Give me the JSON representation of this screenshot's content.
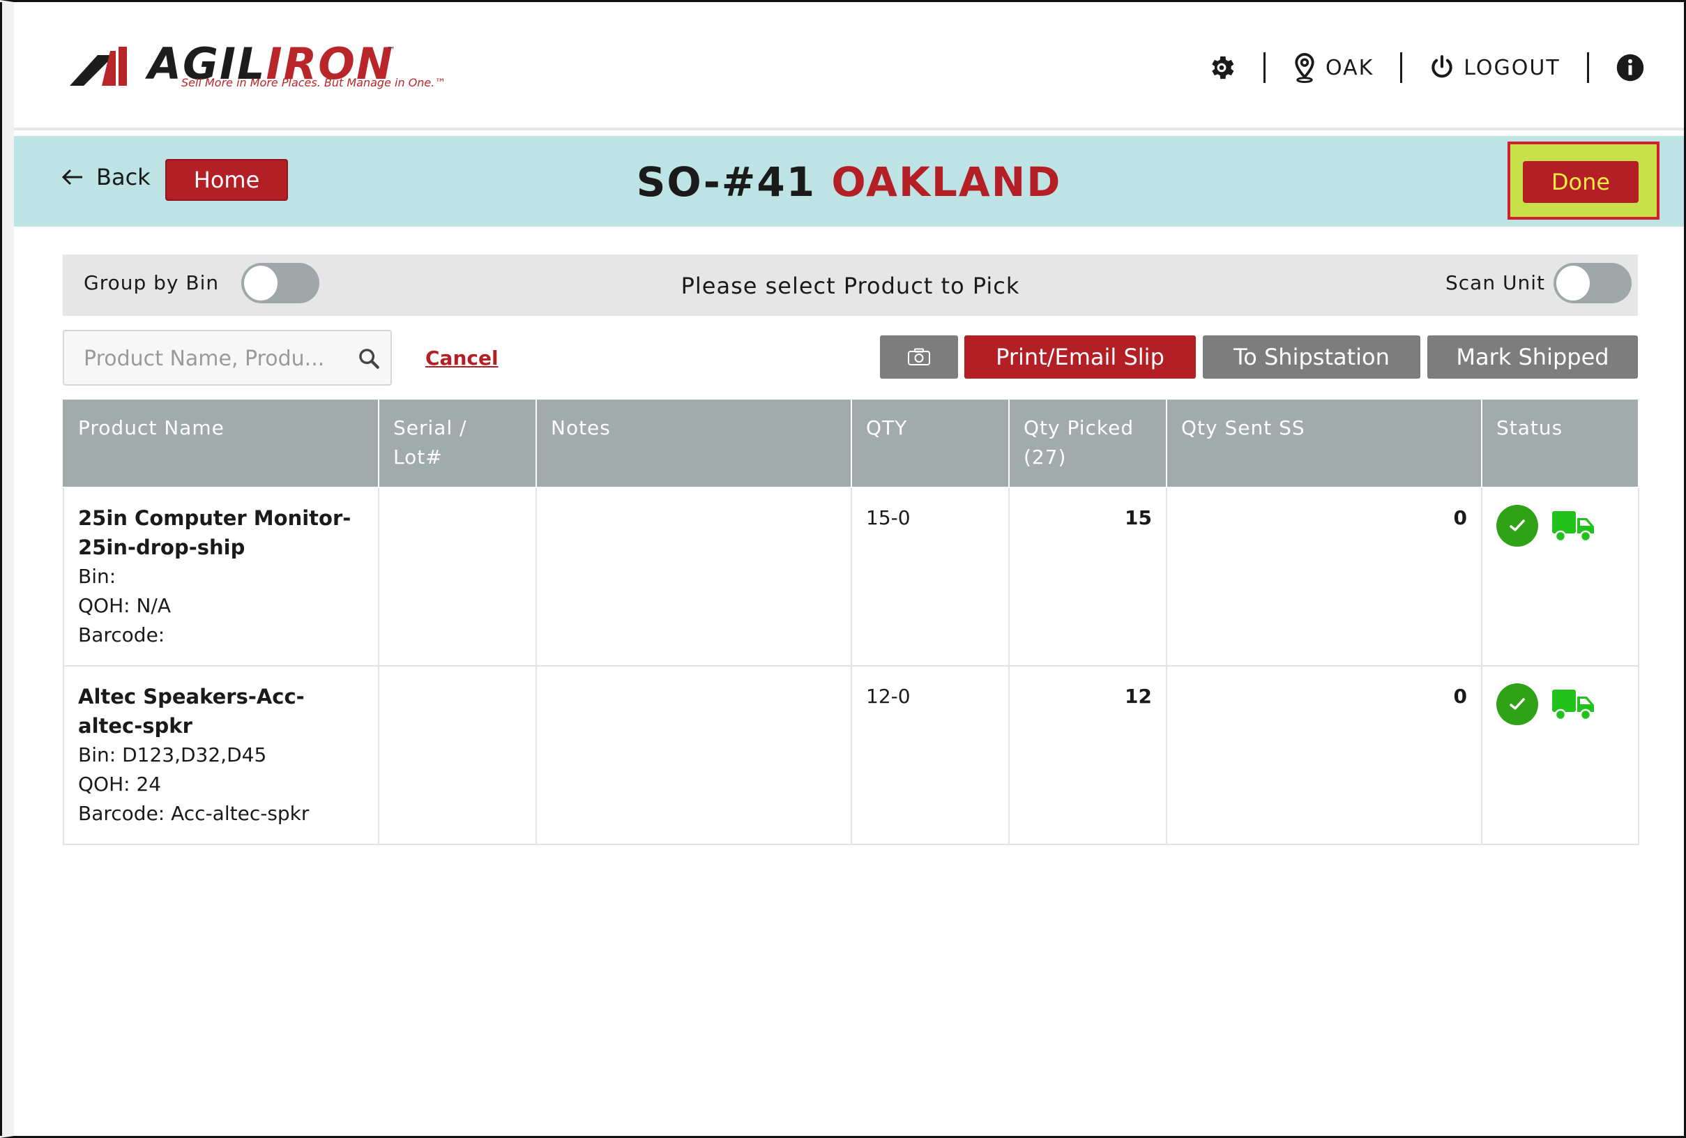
{
  "brand": {
    "name_black": "AGIL",
    "name_red": "IRON",
    "tm": "™",
    "tagline": "Sell More in More Places. But Manage in One.™"
  },
  "topnav": {
    "location": "OAK",
    "logout": "LOGOUT"
  },
  "header": {
    "back_label": "Back",
    "home_label": "Home",
    "order_id": "SO-#41",
    "location_name": "OAKLAND",
    "done_label": "Done"
  },
  "toolbar": {
    "group_by_bin_label": "Group by Bin",
    "instruction": "Please select Product to Pick",
    "scan_unit_label": "Scan Unit"
  },
  "search": {
    "placeholder": "Product Name, Produ...",
    "cancel_label": "Cancel"
  },
  "actions": {
    "print_email_label": "Print/Email Slip",
    "to_shipstation_label": "To Shipstation",
    "mark_shipped_label": "Mark Shipped"
  },
  "table": {
    "headers": [
      "Product Name",
      "Serial / Lot#",
      "Notes",
      "QTY",
      "Qty Picked (27)",
      "Qty Sent SS",
      "Status"
    ],
    "rows": [
      {
        "name": "25in Computer Monitor-25in-drop-ship",
        "bin": "Bin:",
        "qoh": "QOH: N/A",
        "barcode": "Barcode:",
        "serial": "",
        "notes": "",
        "qty": "15-0",
        "qty_picked": "15",
        "qty_sent": "0"
      },
      {
        "name": "Altec Speakers-Acc-altec-spkr",
        "bin": "Bin: D123,D32,D45",
        "qoh": "QOH: 24",
        "barcode": "Barcode: Acc-altec-spkr",
        "serial": "",
        "notes": "",
        "qty": "12-0",
        "qty_picked": "12",
        "qty_sent": "0"
      }
    ]
  },
  "colors": {
    "brand_red": "#b31f25",
    "header_bg": "#bde3e5",
    "status_green": "#30a218",
    "truck_green": "#22c21c"
  }
}
